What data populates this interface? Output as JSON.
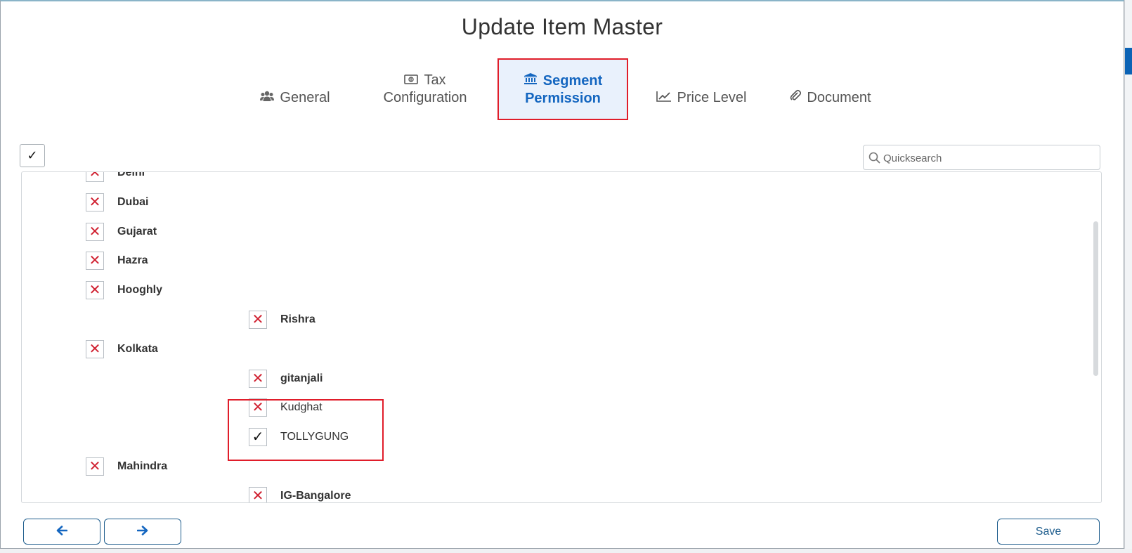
{
  "title": "Update Item Master",
  "tabs": [
    {
      "id": "general",
      "label": "General",
      "icon": "users-icon"
    },
    {
      "id": "tax",
      "label_line1": "Tax",
      "label_line2": "Configuration",
      "icon": "money-icon"
    },
    {
      "id": "segment",
      "label_line1": "Segment",
      "label_line2": "Permission",
      "icon": "bank-icon",
      "active": true
    },
    {
      "id": "price",
      "label": "Price Level",
      "icon": "chart-line-icon"
    },
    {
      "id": "document",
      "label": "Document",
      "icon": "paperclip-icon"
    }
  ],
  "select_all_mark": "✓",
  "search": {
    "placeholder": "Quicksearch"
  },
  "segments": [
    {
      "label": "Delhi",
      "state": "x",
      "level": 0
    },
    {
      "label": "Dubai",
      "state": "x",
      "level": 0
    },
    {
      "label": "Gujarat",
      "state": "x",
      "level": 0
    },
    {
      "label": "Hazra",
      "state": "x",
      "level": 0
    },
    {
      "label": "Hooghly",
      "state": "x",
      "level": 0
    },
    {
      "label": "Rishra",
      "state": "x",
      "level": 1
    },
    {
      "label": "Kolkata",
      "state": "x",
      "level": 0
    },
    {
      "label": "gitanjali",
      "state": "x",
      "level": 1
    },
    {
      "label": "Kudghat",
      "state": "x",
      "level": 1
    },
    {
      "label": "TOLLYGUNG",
      "state": "check",
      "level": 1
    },
    {
      "label": "Mahindra",
      "state": "x",
      "level": 0
    },
    {
      "label": "IG-Bangalore",
      "state": "x",
      "level": 1
    }
  ],
  "buttons": {
    "save": "Save"
  },
  "colors": {
    "accent": "#1466c0",
    "highlight": "#e01d2a",
    "x_mark": "#d02030",
    "button_border": "#1e5d8d"
  }
}
